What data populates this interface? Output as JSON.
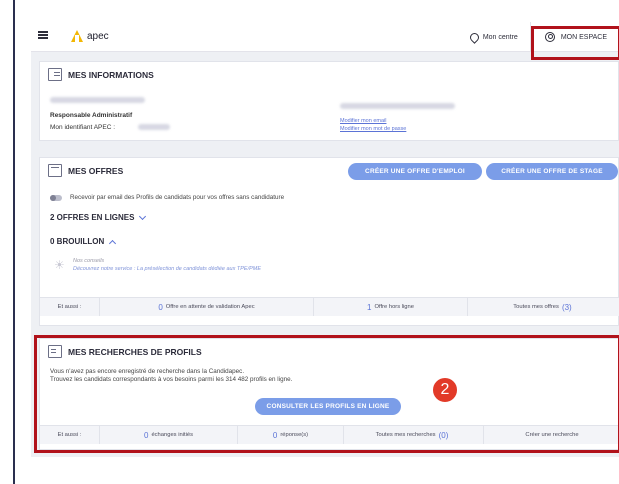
{
  "topbar": {
    "logo_text": "apec",
    "centre_label": "Mon centre",
    "espace_label": "MON ESPACE"
  },
  "infos": {
    "title": "MES INFORMATIONS",
    "role": "Responsable Administratif",
    "identifiant_label": "Mon identifiant APEC :",
    "modify_email": "Modifier mon email",
    "modify_password": "Modifier mon mot de passe"
  },
  "offres": {
    "title": "MES OFFRES",
    "btn_emploi": "CRÉER UNE OFFRE D'EMPLOI",
    "btn_stage": "CRÉER UNE OFFRE DE STAGE",
    "toggle_label": "Recevoir par email des Profils de candidats pour vos offres sans candidature",
    "en_ligne": "2 OFFRES EN LIGNES",
    "brouillon": "0 BROUILLON",
    "conseil_title": "Nos conseils",
    "conseil_text": "Découvrez notre service : La présélection de candidats dédiée aux TPE/PME",
    "strip": {
      "aussi": "Et aussi :",
      "attente_num": "0",
      "attente_label": "Offre en attente de validation Apec",
      "hors_num": "1",
      "hors_label": "Offre hors ligne",
      "toutes_label": "Toutes mes offres",
      "toutes_num": "(3)"
    }
  },
  "recherches": {
    "title": "MES RECHERCHES DE PROFILS",
    "line1": "Vous n'avez pas encore enregistré de recherche dans la Candidapec.",
    "line2": "Trouvez les candidats correspondants à vos besoins parmi les 314 482 profils en ligne.",
    "btn": "CONSULTER LES PROFILS EN LIGNE",
    "strip": {
      "aussi": "Et aussi :",
      "echanges_num": "0",
      "echanges_label": "échanges initiés",
      "reponses_num": "0",
      "reponses_label": "réponse(s)",
      "toutes_label": "Toutes mes recherches",
      "toutes_num": "(0)",
      "creer_label": "Créer une recherche"
    }
  },
  "annotation": {
    "badge": "2"
  },
  "colors": {
    "annotation_red": "#b1121b",
    "badge_red": "#e23a28",
    "button_blue": "#7b9de8",
    "link_blue": "#5b73d6"
  }
}
